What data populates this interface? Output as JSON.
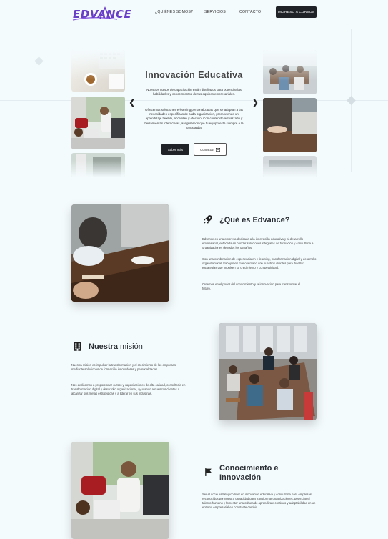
{
  "brand": {
    "logo_text": "EDVANCE",
    "accent": "#6a3fc8"
  },
  "nav": {
    "links": [
      "¿QUIÉNES SOMOS?",
      "SERVICIOS",
      "CONTACTO"
    ],
    "cta": "INGRESO A CURSOS"
  },
  "hero": {
    "title": "Innovación Educativa",
    "p1": "Nuestros cursos de capacitación están diseñados para potenciar las habilidades y conocimientos de tus equipos empresariales.",
    "p2": "Ofrecemos soluciones e-learning personalizadas que se adaptan a las necesidades específicas de cada organización, promoviendo un aprendizaje flexible, accesible y efectivo. Con contenido actualizado y herramientas interactivas, aseguramos que tu equipo esté siempre a la vanguardia.",
    "btn_primary": "Saber más",
    "btn_secondary": "Contactar",
    "prev_icon": "chevron-left-icon",
    "next_icon": "chevron-right-icon"
  },
  "about": {
    "title": "¿Qué es Edvance?",
    "icon": "rocket-icon",
    "p1": "Edvance es una empresa dedicada a la innovación educativa y al desarrollo empresarial, enfocada en brindar soluciones integrales de formación y consultoría a organizaciones de todos los tamaños.",
    "p2": "Con una combinación de experiencia en e-learning, transformación digital y desarrollo organizacional, trabajamos mano a mano con nuestros clientes para diseñar estrategias que impulsen su crecimiento y competitividad.",
    "p3": "Creemos en el poder del conocimiento y la innovación para transformar el futuro."
  },
  "mission": {
    "title_bold": "Nuestra",
    "title_light": "misión",
    "icon": "building-icon",
    "p1": "Nuestra misión es impulsar la transformación y el crecimiento de las empresas mediante soluciones de formación innovadoras y personalizadas.",
    "p2": "Nos dedicamos a proporcionar cursos y capacitaciones de alta calidad, consultoría en transformación digital y desarrollo organizacional, ayudando a nuestros clientes a alcanzar sus metas estratégicas y a liderar en sus industrias."
  },
  "vision": {
    "title_line1": "Conocimiento e",
    "title_line2": "Innovación",
    "icon": "flag-icon",
    "p1": "Ser el socio estratégico líder en innovación educativa y consultoría para empresas, reconocidos por nuestra capacidad para transformar organizaciones, potenciar el talento humano y fomentar una cultura de aprendizaje continuo y adaptabilidad en un entorno empresarial en constante cambio."
  }
}
